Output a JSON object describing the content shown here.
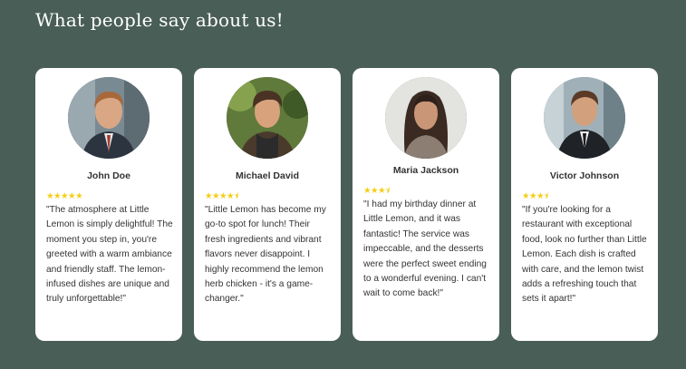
{
  "section": {
    "title": "What people say about us!"
  },
  "colors": {
    "background": "#495E57",
    "card": "#FFFFFF",
    "star": "#F4CE14",
    "text": "#333333"
  },
  "testimonials": [
    {
      "name": "John Doe",
      "stars": "★★★★★",
      "quote": "\"The atmosphere at Little Lemon is simply delightful! The moment you step in, you're greeted with a warm ambiance and friendly staff. The lemon-infused dishes are unique and truly unforgettable!\""
    },
    {
      "name": "Michael David",
      "stars": "★★★★⯨",
      "quote": "\"Little Lemon has become my go-to spot for lunch! Their fresh ingredients and vibrant flavors never disappoint. I highly recommend the lemon herb chicken - it's a game-changer.\""
    },
    {
      "name": "Maria Jackson",
      "stars": "★★★⯨",
      "quote": "\"I had my birthday dinner at Little Lemon, and it was fantastic! The service was impeccable, and the desserts were the perfect sweet ending to a wonderful evening. I can't wait to come back!\""
    },
    {
      "name": "Victor Johnson",
      "stars": "★★★⯨",
      "quote": "\"If you're looking for a restaurant with exceptional food, look no further than Little Lemon. Each dish is crafted with care, and the lemon twist adds a refreshing touch that sets it apart!\""
    }
  ]
}
